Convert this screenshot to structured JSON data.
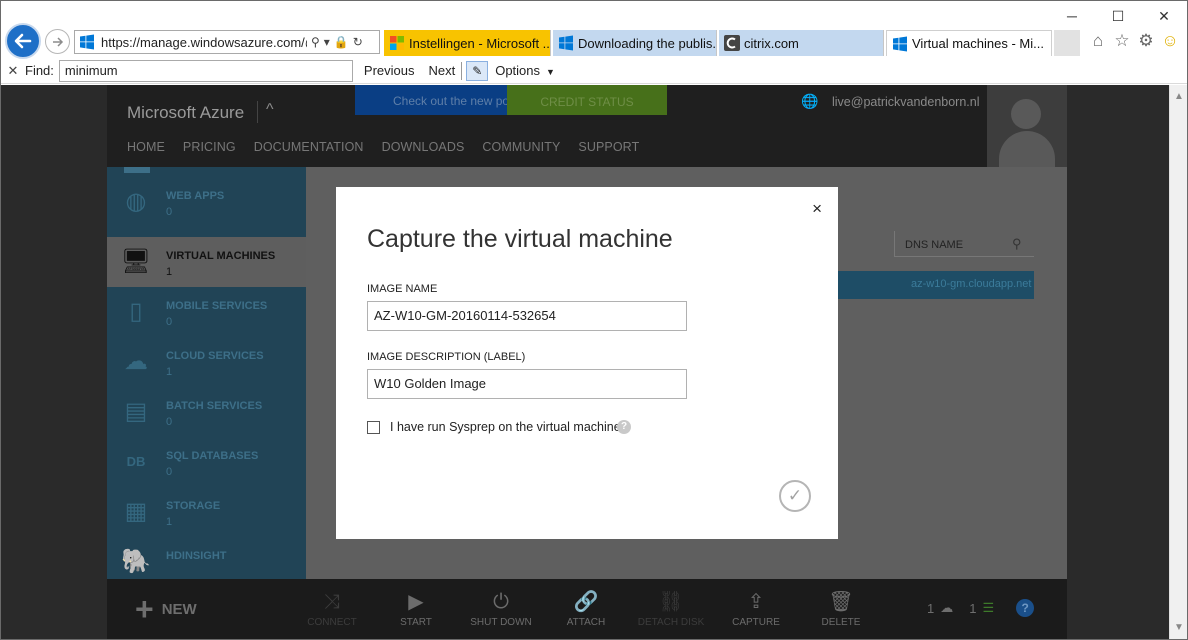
{
  "browser": {
    "address_url": "https://manage.windowsazure.com/@fc",
    "tabs": [
      {
        "title": "Instellingen - Microsoft ..."
      },
      {
        "title": "Downloading the publis..."
      },
      {
        "title": "citrix.com"
      },
      {
        "title": "Virtual machines - Mi...",
        "close": "×"
      }
    ],
    "find": {
      "label": "Find:",
      "value": "minimum",
      "previous": "Previous",
      "next": "Next",
      "options": "Options"
    },
    "window": {
      "minimize": "─",
      "maximize": "☐",
      "close": "✕"
    }
  },
  "portal": {
    "brand": "Microsoft Azure",
    "promo_new": "Check out the new port",
    "promo_credit": "CREDIT STATUS",
    "user_email": "live@patrickvandenborn.nl",
    "nav": [
      "HOME",
      "PRICING",
      "DOCUMENTATION",
      "DOWNLOADS",
      "COMMUNITY",
      "SUPPORT"
    ],
    "sidebar": [
      {
        "label": "WEB APPS",
        "count": "0"
      },
      {
        "label": "VIRTUAL MACHINES",
        "count": "1"
      },
      {
        "label": "MOBILE SERVICES",
        "count": "0"
      },
      {
        "label": "CLOUD SERVICES",
        "count": "1"
      },
      {
        "label": "BATCH SERVICES",
        "count": "0"
      },
      {
        "label": "SQL DATABASES",
        "count": "0"
      },
      {
        "label": "STORAGE",
        "count": "1"
      },
      {
        "label": "HDINSIGHT",
        "count": ""
      }
    ],
    "table": {
      "dns_header": "DNS NAME",
      "dns_value": "az-w10-gm.cloudapp.net"
    },
    "commands": {
      "new": "NEW",
      "connect": "CONNECT",
      "start": "START",
      "shutdown": "SHUT DOWN",
      "attach": "ATTACH",
      "detach_disk": "DETACH DISK",
      "capture": "CAPTURE",
      "delete": "DELETE"
    },
    "status": {
      "cloud_count": "1",
      "progress_count": "1",
      "help": "?"
    }
  },
  "modal": {
    "title": "Capture the virtual machine",
    "close": "×",
    "image_name_label": "IMAGE NAME",
    "image_name_value": "AZ-W10-GM-20160114-532654",
    "image_desc_label": "IMAGE DESCRIPTION (LABEL)",
    "image_desc_value": "W10 Golden Image",
    "sysprep_label": "I have run Sysprep on the virtual machine",
    "sysprep_checked": false,
    "help": "?",
    "confirm": "✓"
  }
}
